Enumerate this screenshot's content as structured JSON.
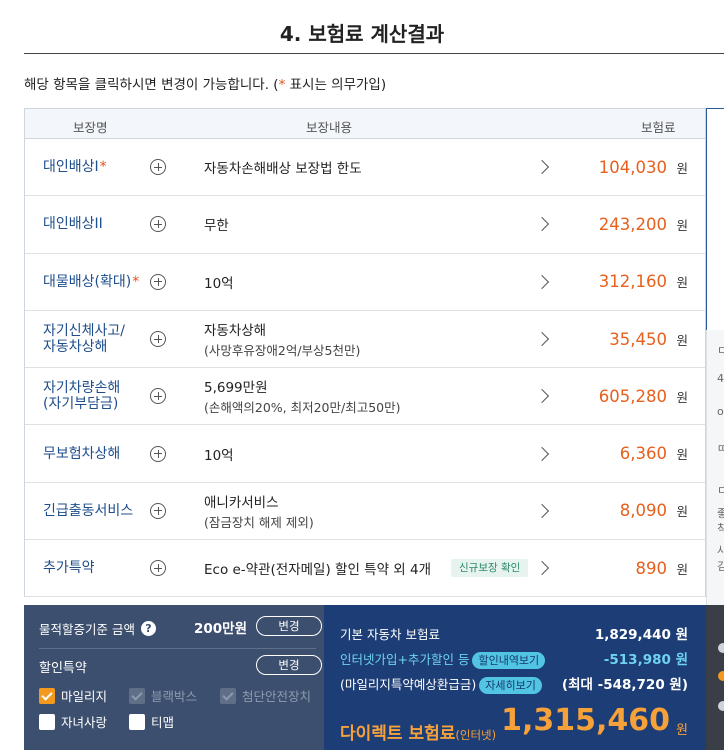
{
  "page": {
    "title": "4. 보험료 계산결과",
    "notice_prefix": "해당 항목을 클릭하시면 변경이 가능합니다. (",
    "notice_star": "*",
    "notice_suffix": " 표시는 의무가입)"
  },
  "table": {
    "headers": {
      "coverage_name": "보장명",
      "coverage_detail": "보장내용",
      "premium": "보험료"
    },
    "won": "원",
    "rows": [
      {
        "name": "대인배상I",
        "required": "*",
        "detail": "자동차손해배상 보장법 한도",
        "sub": "",
        "price": "104,030"
      },
      {
        "name": "대인배상II",
        "required": "",
        "detail": "무한",
        "sub": "",
        "price": "243,200"
      },
      {
        "name": "대물배상(확대)",
        "required": "*",
        "detail": "10억",
        "sub": "",
        "price": "312,160"
      },
      {
        "name_l1": "자기신체사고/",
        "name_l2": "자동차상해",
        "detail": "자동차상해",
        "sub": "(사망후유장애2억/부상5천만)",
        "price": "35,450"
      },
      {
        "name_l1": "자기차량손해",
        "name_l2": "(자기부담금)",
        "detail": "5,699만원",
        "sub": "(손해액의20%, 최저20만/최고50만)",
        "price": "605,280"
      },
      {
        "name": "무보험차상해",
        "required": "",
        "detail": "10억",
        "sub": "",
        "price": "6,360"
      },
      {
        "name": "긴급출동서비스",
        "required": "",
        "detail": "애니카서비스",
        "sub": "(잠금장치 해제 제외)",
        "price": "8,090"
      },
      {
        "name": "추가특약",
        "required": "",
        "detail": "Eco e-약관(전자메일) 할인 특약 외 4개",
        "sub": "",
        "badge": "신규보장 확인",
        "price": "890"
      }
    ]
  },
  "side_panel": {
    "glyphs": [
      "ㄷ",
      "4",
      "o",
      "ㄸ",
      "ㄷ",
      "좋",
      "칙",
      "사",
      "김"
    ]
  },
  "summary_left": {
    "mileage_label": "물적할증기준 금액",
    "help_icon": "?",
    "mileage_value": "200만원",
    "change_button": "변경",
    "special_label": "할인특약",
    "special_change_button": "변경",
    "options": [
      {
        "label": "마일리지",
        "state": "checked"
      },
      {
        "label": "블랙박스",
        "state": "disabled"
      },
      {
        "label": "첨단안전장치",
        "state": "disabled"
      },
      {
        "label": "자녀사랑",
        "state": "unchecked"
      },
      {
        "label": "티맵",
        "state": "unchecked"
      }
    ]
  },
  "summary_right": {
    "base_label": "기본 자동차 보험료",
    "base_value": "1,829,440 원",
    "discount_label": "인터넷가입+추가할인 등",
    "discount_pill": "할인내역보기",
    "discount_value": "-513,980 원",
    "mileage_label": "(마일리지특약예상환급금)",
    "mileage_pill": "자세히보기",
    "mileage_value": "(최대 -548,720 원)",
    "final_label": "다이렉트 보험료",
    "final_suffix": "(인터넷)",
    "final_value": "1,315,460",
    "final_won": "원"
  },
  "colors": {
    "accent_orange": "#e8601d",
    "navy": "#1c3d75",
    "slate": "#3c4f6e",
    "link_blue": "#1f4e8c"
  }
}
